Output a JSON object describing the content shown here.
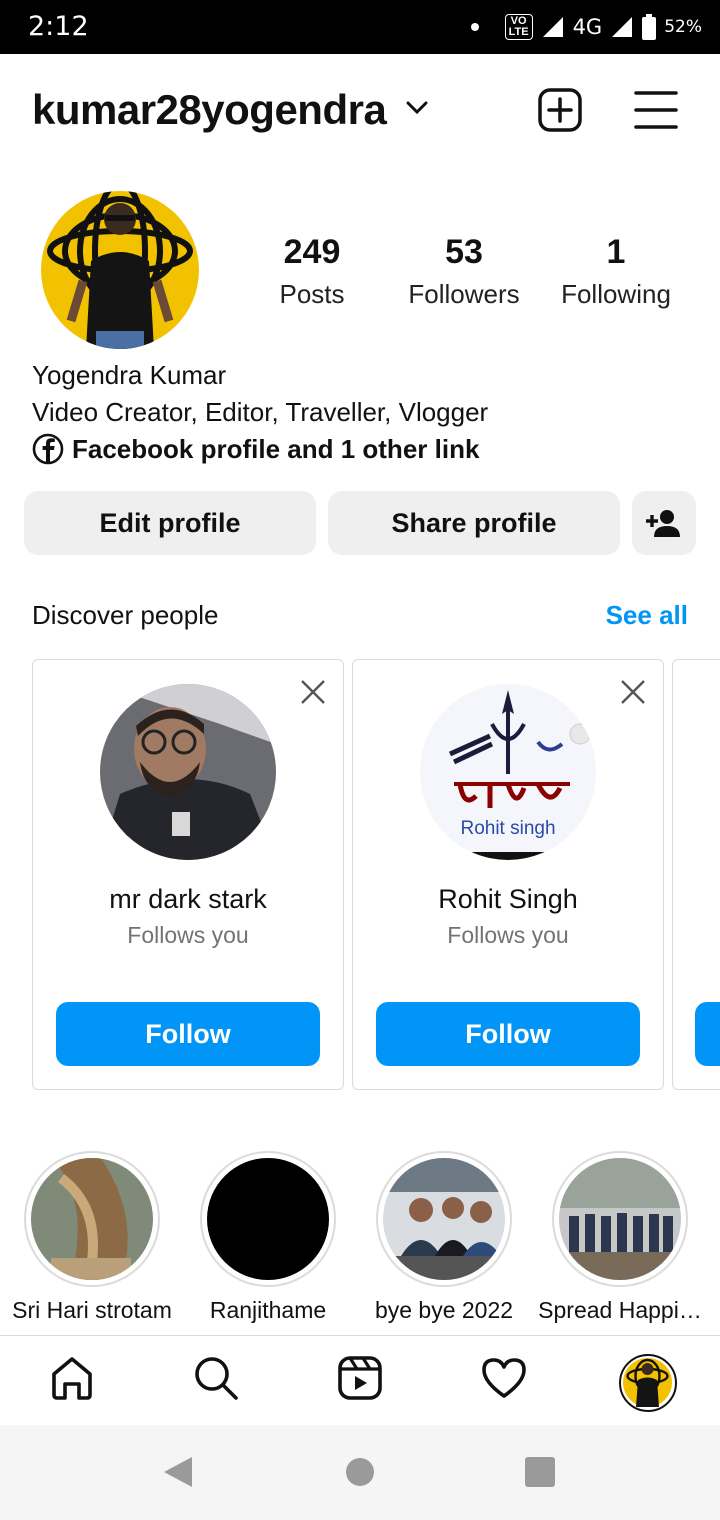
{
  "status_bar": {
    "time": "2:12",
    "volte": "VO\nLTE",
    "network": "4G",
    "battery": "52%"
  },
  "header": {
    "username": "kumar28yogendra",
    "icons": [
      "chevron-down-icon",
      "create-plus-icon",
      "hamburger-menu-icon"
    ]
  },
  "profile": {
    "stats": [
      {
        "value": "249",
        "label": "Posts"
      },
      {
        "value": "53",
        "label": "Followers"
      },
      {
        "value": "1",
        "label": "Following"
      }
    ],
    "full_name": "Yogendra Kumar",
    "bio": "Video Creator, Editor, Traveller, Vlogger",
    "link": "Facebook profile and 1 other link"
  },
  "actions": {
    "edit": "Edit profile",
    "share": "Share profile"
  },
  "discover": {
    "title": "Discover people",
    "see_all": "See all",
    "cards": [
      {
        "name": "mr dark stark",
        "subtitle": "Follows you",
        "button": "Follow"
      },
      {
        "name": "Rohit Singh",
        "subtitle": "Follows you",
        "button": "Follow"
      }
    ]
  },
  "highlights": [
    {
      "label": "Sri Hari strotam"
    },
    {
      "label": "Ranjithame"
    },
    {
      "label": "bye bye 2022"
    },
    {
      "label": "Spread Happi…"
    }
  ],
  "colors": {
    "accent": "#0095f6",
    "button_grey": "#efefef",
    "notification_dot": "#ff3040"
  }
}
